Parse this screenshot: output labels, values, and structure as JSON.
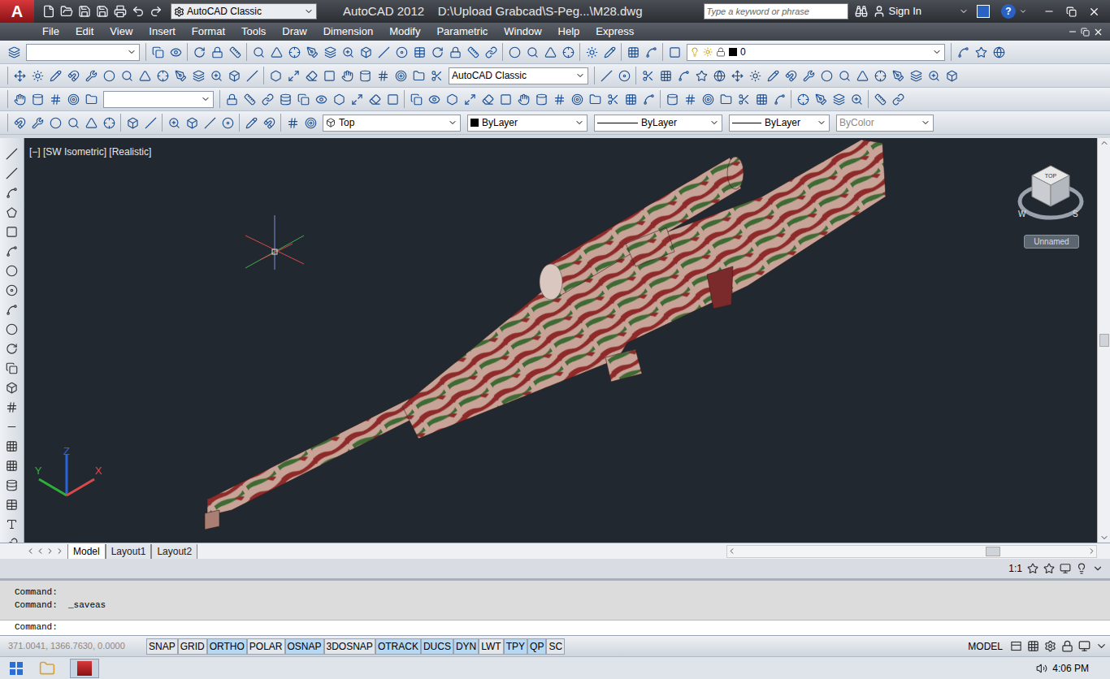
{
  "title_bar": {
    "logo": "A",
    "workspace": "AutoCAD Classic",
    "title": "AutoCAD 2012    D:\\Upload Grabcad\\S-Peg...\\M28.dwg",
    "search_placeholder": "Type a keyword or phrase",
    "sign_in": "Sign In",
    "help": "?"
  },
  "menu": [
    "File",
    "Edit",
    "View",
    "Insert",
    "Format",
    "Tools",
    "Draw",
    "Dimension",
    "Modify",
    "Parametric",
    "Window",
    "Help",
    "Express"
  ],
  "toolbars": {
    "layer": "0",
    "workspace": "AutoCAD Classic",
    "view": "Top",
    "color": "ByLayer",
    "linetype": "ByLayer",
    "lineweight": "ByLayer",
    "plot_style": {
      "label": "ByColor",
      "disabled": true
    }
  },
  "viewport": {
    "label": "[−] [SW Isometric] [Realistic]",
    "viewcube": {
      "top": "TOP",
      "west": "W",
      "south": "S",
      "named_view": "Unnamed"
    },
    "ucs": {
      "x": "X",
      "y": "Y",
      "z": "Z"
    }
  },
  "layout_tabs": [
    {
      "label": "Model",
      "selected": true
    },
    {
      "label": "Layout1",
      "selected": false
    },
    {
      "label": "Layout2",
      "selected": false
    }
  ],
  "annotation_scale": "1:1",
  "command_history": [
    "Command:",
    "Command:  _saveas"
  ],
  "command_prompt": "Command:",
  "status_bar": {
    "coordinates": "371.0041, 1366.7630, 0.0000",
    "toggles": [
      {
        "label": "SNAP",
        "on": false
      },
      {
        "label": "GRID",
        "on": false
      },
      {
        "label": "ORTHO",
        "on": true
      },
      {
        "label": "POLAR",
        "on": false
      },
      {
        "label": "OSNAP",
        "on": true
      },
      {
        "label": "3DOSNAP",
        "on": false
      },
      {
        "label": "OTRACK",
        "on": true
      },
      {
        "label": "DUCS",
        "on": true
      },
      {
        "label": "DYN",
        "on": true
      },
      {
        "label": "LWT",
        "on": false
      },
      {
        "label": "TPY",
        "on": true
      },
      {
        "label": "QP",
        "on": true
      },
      {
        "label": "SC",
        "on": false
      }
    ],
    "space": "MODEL"
  },
  "taskbar": {
    "time": "4:06 PM"
  }
}
